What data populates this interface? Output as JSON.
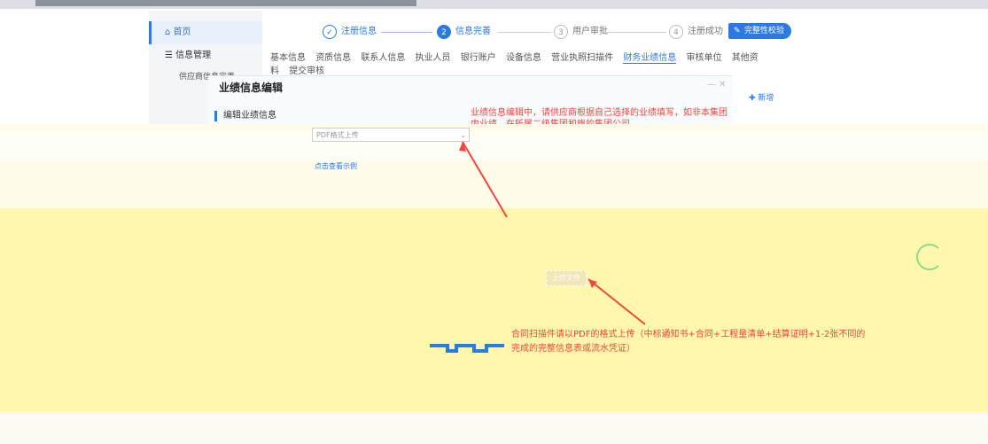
{
  "sidebar": {
    "items": [
      {
        "label": "首页"
      },
      {
        "label": "信息管理"
      },
      {
        "label": "供应商信息完善"
      }
    ]
  },
  "steps": [
    {
      "num": "✓",
      "label": "注册信息"
    },
    {
      "num": "2",
      "label": "信息完善"
    },
    {
      "num": "3",
      "label": "用户审批"
    },
    {
      "num": "4",
      "label": "注册成功"
    }
  ],
  "check_button": "完整性校验",
  "tabs": [
    "基本信息",
    "资质信息",
    "联系人信息",
    "执业人员",
    "银行账户",
    "设备信息",
    "营业执照扫描件",
    "财务业绩信息",
    "审核单位",
    "其他资料",
    "提交审核"
  ],
  "modal": {
    "title": "业绩信息编辑",
    "section": "编辑业绩信息",
    "add_button": "新增",
    "select_placeholder": "PDF格式上传",
    "link_text": "点击查看示例"
  },
  "hints": {
    "top": "业绩信息编辑中，请供应商根据自己选择的业绩填写，如非本集团内业绩，在所属二级集团和旗的集团公司。",
    "bottom": "合同扫描件请以PDF的格式上传（中标通知书+合同+工程量清单+结算证明+1-2张不同的完成的完整信息表或流水凭证）"
  },
  "upload_label": "上传文件",
  "colors": {
    "primary": "#2a7ae2",
    "hint": "#f0463b",
    "yellow": "#fff7ad"
  }
}
